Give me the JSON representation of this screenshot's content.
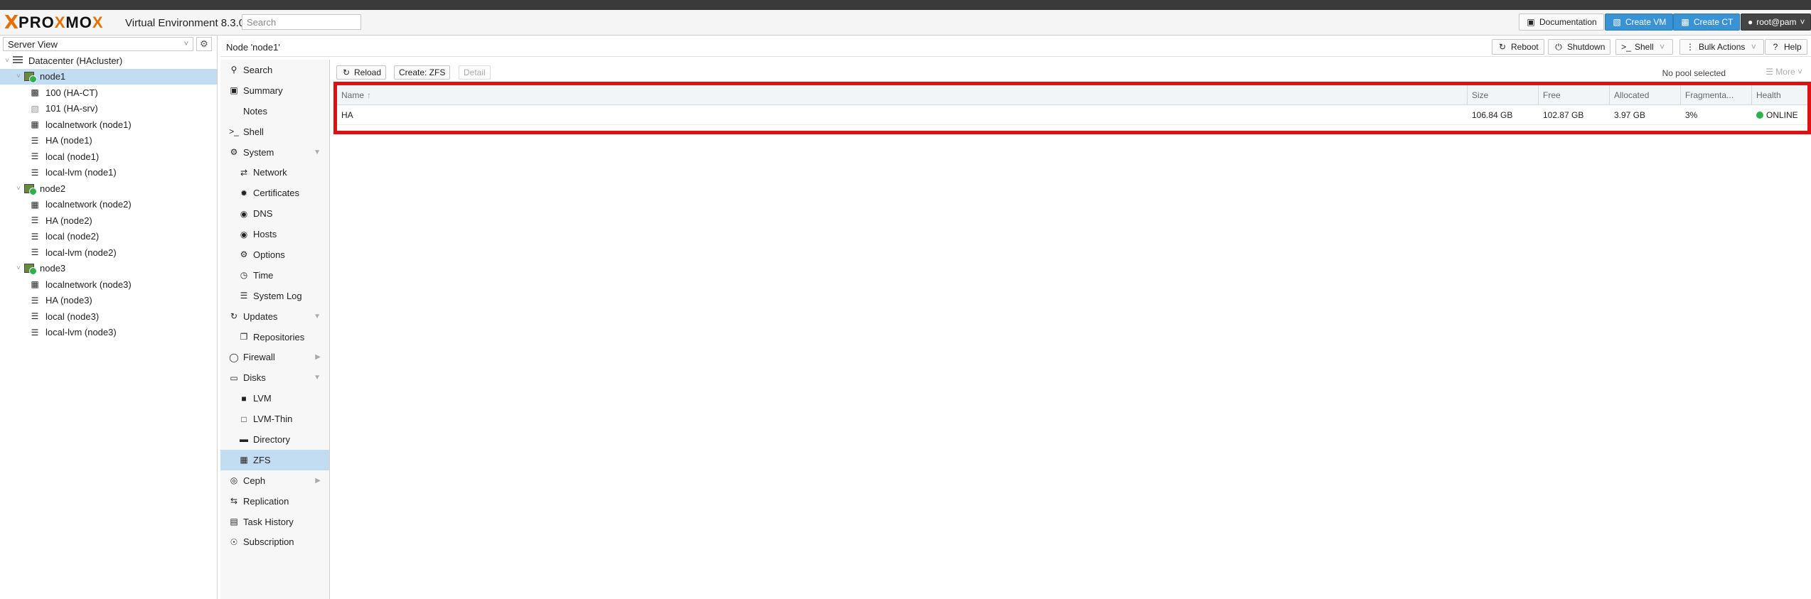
{
  "app": {
    "logo_x": "X",
    "logo_pro": "PRO",
    "logo_x2": "X",
    "logo_mo": "MO",
    "logo_x3": "X",
    "version": "Virtual Environment 8.3.0",
    "search_placeholder": "Search"
  },
  "topbar": {
    "documentation": "Documentation",
    "create_vm": "Create VM",
    "create_ct": "Create CT",
    "user": "root@pam"
  },
  "tree": {
    "view": "Server View",
    "items": [
      {
        "label": "Datacenter (HAcluster)"
      },
      {
        "label": "node1"
      },
      {
        "label": "100 (HA-CT)"
      },
      {
        "label": "101 (HA-srv)"
      },
      {
        "label": "localnetwork (node1)"
      },
      {
        "label": "HA (node1)"
      },
      {
        "label": "local (node1)"
      },
      {
        "label": "local-lvm (node1)"
      },
      {
        "label": "node2"
      },
      {
        "label": "localnetwork (node2)"
      },
      {
        "label": "HA (node2)"
      },
      {
        "label": "local (node2)"
      },
      {
        "label": "local-lvm (node2)"
      },
      {
        "label": "node3"
      },
      {
        "label": "localnetwork (node3)"
      },
      {
        "label": "HA (node3)"
      },
      {
        "label": "local (node3)"
      },
      {
        "label": "local-lvm (node3)"
      }
    ]
  },
  "content": {
    "title": "Node 'node1'",
    "reboot": "Reboot",
    "shutdown": "Shutdown",
    "shell": "Shell",
    "bulk_actions": "Bulk Actions",
    "help": "Help"
  },
  "menu": {
    "items": [
      {
        "label": "Search"
      },
      {
        "label": "Summary"
      },
      {
        "label": "Notes"
      },
      {
        "label": "Shell"
      },
      {
        "label": "System"
      },
      {
        "label": "Network"
      },
      {
        "label": "Certificates"
      },
      {
        "label": "DNS"
      },
      {
        "label": "Hosts"
      },
      {
        "label": "Options"
      },
      {
        "label": "Time"
      },
      {
        "label": "System Log"
      },
      {
        "label": "Updates"
      },
      {
        "label": "Repositories"
      },
      {
        "label": "Firewall"
      },
      {
        "label": "Disks"
      },
      {
        "label": "LVM"
      },
      {
        "label": "LVM-Thin"
      },
      {
        "label": "Directory"
      },
      {
        "label": "ZFS"
      },
      {
        "label": "Ceph"
      },
      {
        "label": "Replication"
      },
      {
        "label": "Task History"
      },
      {
        "label": "Subscription"
      }
    ]
  },
  "zfs": {
    "reload": "Reload",
    "create": "Create: ZFS",
    "detail": "Detail",
    "no_pool": "No pool selected",
    "more": "More",
    "columns": {
      "name": "Name",
      "size": "Size",
      "free": "Free",
      "allocated": "Allocated",
      "fragmentation": "Fragmenta...",
      "health": "Health"
    },
    "rows": [
      {
        "name": "HA",
        "size": "106.84 GB",
        "free": "102.87 GB",
        "allocated": "3.97 GB",
        "fragmentation": "3%",
        "health": "ONLINE"
      }
    ],
    "colors": {
      "highlight_border": "#e01010",
      "online": "#2bb24c"
    }
  }
}
